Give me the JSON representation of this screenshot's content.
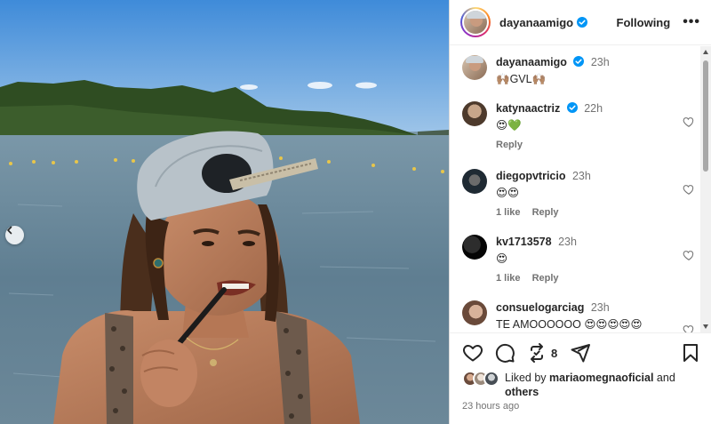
{
  "post": {
    "author": "dayanaamigo",
    "follow_label": "Following",
    "more_label": "•••"
  },
  "comments": [
    {
      "user": "dayanaamigo",
      "time": "23h",
      "text": "🙌🏽GVL🙌🏽",
      "likes": "",
      "reply": ""
    },
    {
      "user": "katynaactriz",
      "time": "22h",
      "text": "😍💚",
      "likes": "",
      "reply": "Reply"
    },
    {
      "user": "diegopvtricio",
      "time": "23h",
      "text": "😍😍",
      "likes": "1 like",
      "reply": "Reply"
    },
    {
      "user": "kv1713578",
      "time": "23h",
      "text": "😍",
      "likes": "1 like",
      "reply": "Reply"
    },
    {
      "user": "consuelogarciag",
      "time": "23h",
      "text": "TE AMOOOOOO 😍😍😍😍😍",
      "likes": "",
      "reply": ""
    }
  ],
  "actions": {
    "repost_count": "8"
  },
  "likes": {
    "prefix": "Liked by ",
    "user": "mariaomegnaoficial",
    "and": " and ",
    "others": "others"
  },
  "timestamp": "23 hours ago",
  "icons": {
    "prev": "chevron-left-icon",
    "like": "heart-icon",
    "comment": "comment-icon",
    "repost": "repost-icon",
    "share": "send-icon",
    "save": "bookmark-icon",
    "verified": "verified-badge-icon",
    "more": "more-options-icon"
  },
  "colors": {
    "verified": "#0095f6",
    "text": "#262626",
    "muted": "#737373",
    "sky": "#5f9ad6",
    "water": "#6e8fa7"
  }
}
